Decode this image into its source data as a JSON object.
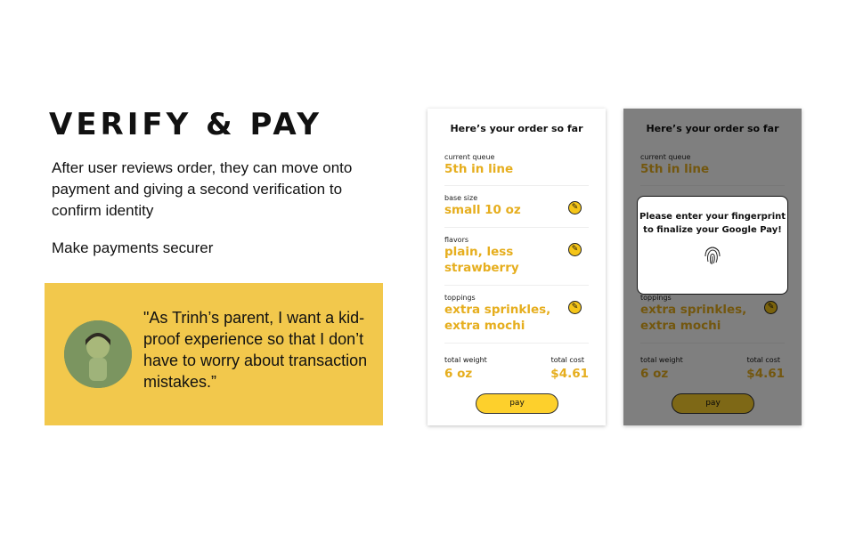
{
  "heading": "VERIFY & PAY",
  "description": "After user reviews order, they can move onto payment and giving a second verification to confirm identity",
  "subpoint": "Make payments securer",
  "quote": "\"As Trinh’s parent, I want a kid-proof experience so that I don’t have to worry about transaction mistakes.”",
  "phone": {
    "title": "Here’s your order so far",
    "queue_label": "current queue",
    "queue_value": "5th in line",
    "size_label": "base size",
    "size_value": "small 10 oz",
    "flavors_label": "flavors",
    "flavors_value": "plain, less strawberry",
    "toppings_label": "toppings",
    "toppings_value": "extra sprinkles, extra mochi",
    "weight_label": "total weight",
    "weight_value": "6 oz",
    "cost_label": "total cost",
    "cost_value": "$4.61",
    "pay_label": "pay"
  },
  "modal": {
    "message": "Please enter your fingerprint to finalize your Google Pay!",
    "icon": "fingerprint-icon"
  },
  "colors": {
    "accent": "#e6ae1e",
    "panel": "#f2c84c",
    "button": "#fdd02c"
  }
}
